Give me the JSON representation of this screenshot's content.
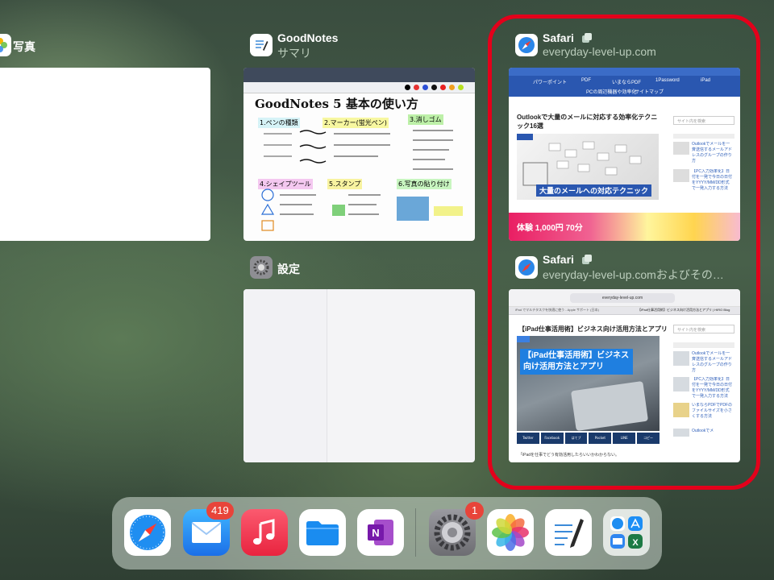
{
  "switcher": {
    "photos": {
      "name": "写真"
    },
    "goodnotes": {
      "name": "GoodNotes",
      "subtitle": "サマリ",
      "note_title": "GoodNotes 5 基本の使い方",
      "items": [
        "1.ペンの種類",
        "2.マーカー(蛍光ペン)",
        "3.消しゴム",
        "4.シェイプツール",
        "5.スタンプ",
        "6.写真の貼り付け"
      ]
    },
    "settings": {
      "name": "設定"
    },
    "safari1": {
      "name": "Safari",
      "subtitle": "everyday-level-up.com",
      "nav": [
        "パワーポイント",
        "PDF",
        "いまならPDF",
        "1Password",
        "iPad",
        "PCの周辺機器や効率化",
        "サイトマップ"
      ],
      "article_title": "Outlookで大量のメールに対応する効率化テクニック16選",
      "banner_text": "大量のメールへの対応テクニック",
      "search_placeholder": "サイト内を検索",
      "ad_text": "体験 1,000円 70分"
    },
    "safari2": {
      "name": "Safari",
      "subtitle": "everyday-level-up.comおよびその…",
      "url": "everyday-level-up.com",
      "tab_left": "iPad でマルチタスクを快適に使う - Apple サポート (日本)",
      "tab_right": "【iPad仕事活用術】ビジネス向け活用方法とアプリ | HIRO Blog",
      "article_title": "【iPad仕事活用術】ビジネス向け活用方法とアプリ",
      "hero_text": "【iPad仕事活用術】ビジネス向け活用方法とアプリ",
      "search_placeholder": "サイト内を検索",
      "share": [
        "Twitter",
        "Facebook",
        "はてブ",
        "Pocket",
        "LINE",
        "コピー"
      ],
      "body_text": "「iPadを仕事でどう有効活用したらいいかわからない。",
      "sidebar_links": [
        "Outlookでメールを一斉送信するメールアドレスのグループの作り方",
        "【PC入力効率化】日付を一発で今日の日付をYYYY/MM/DD形式で一発入力する方法",
        "いまならPDFでPDFのファイルサイズを小さくする方法",
        "Outlookでメ"
      ]
    }
  },
  "dock": {
    "apps": [
      {
        "name": "Safari",
        "icon": "safari-icon"
      },
      {
        "name": "メール",
        "icon": "mail-icon",
        "badge": "419"
      },
      {
        "name": "ミュージック",
        "icon": "music-icon"
      },
      {
        "name": "ファイル",
        "icon": "files-icon"
      },
      {
        "name": "OneNote",
        "icon": "onenote-icon"
      },
      {
        "name": "設定",
        "icon": "settings-icon",
        "badge": "1"
      },
      {
        "name": "写真",
        "icon": "photos-icon"
      },
      {
        "name": "GoodNotes",
        "icon": "goodnotes-icon"
      },
      {
        "name": "最近使ったApp",
        "icon": "app-library-icon"
      }
    ]
  },
  "highlight_color": "#e3001b"
}
